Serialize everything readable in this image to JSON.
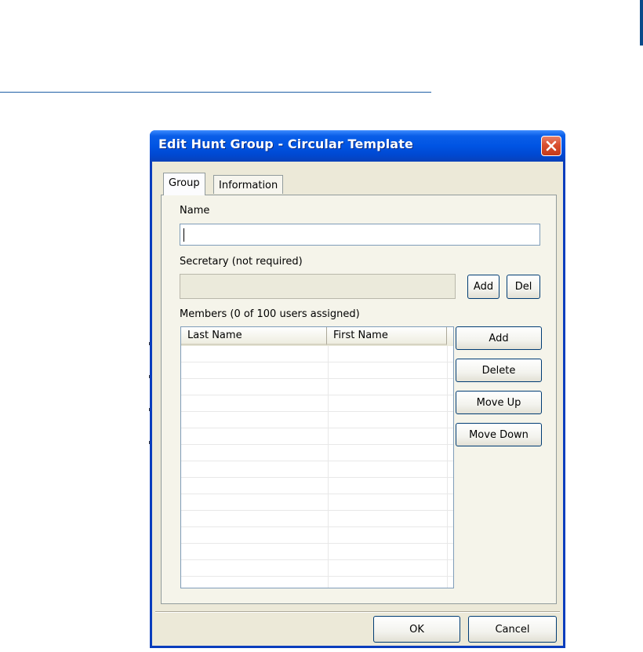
{
  "dialog": {
    "title": "Edit Hunt Group - Circular Template",
    "tabs": [
      {
        "label": "Group",
        "active": true
      },
      {
        "label": "Information",
        "active": false
      }
    ],
    "name_label": "Name",
    "name_value": "",
    "secretary_label": "Secretary (not required)",
    "secretary_value": "",
    "secretary_add": "Add",
    "secretary_del": "Del",
    "members_label": "Members (0 of 100 users assigned)",
    "columns": [
      "Last Name",
      "First Name"
    ],
    "member_buttons": {
      "add": "Add",
      "delete": "Delete",
      "move_up": "Move Up",
      "move_down": "Move Down"
    },
    "ok": "OK",
    "cancel": "Cancel"
  },
  "colors": {
    "titlebar": "#0054e3",
    "dialog_bg": "#ece9d8",
    "close_button": "#d94f2e"
  }
}
